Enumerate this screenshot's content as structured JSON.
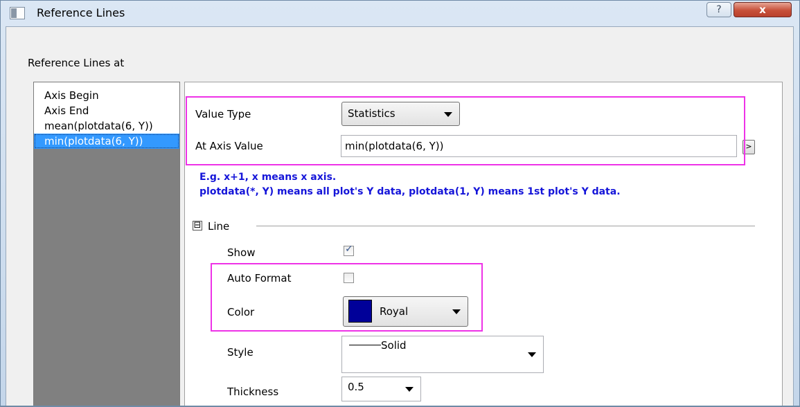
{
  "window": {
    "title": "Reference Lines",
    "help_glyph": "?",
    "close_glyph": "x"
  },
  "group_label": "Reference Lines at",
  "ref_list": {
    "items": [
      {
        "label": "Axis Begin",
        "selected": false
      },
      {
        "label": "Axis End",
        "selected": false
      },
      {
        "label": "mean(plotdata(6, Y))",
        "selected": false
      },
      {
        "label": "min(plotdata(6, Y))",
        "selected": true
      }
    ]
  },
  "value_type": {
    "label": "Value Type",
    "selected": "Statistics"
  },
  "axis_value": {
    "label": "At Axis Value",
    "value": "min(plotdata(6, Y))",
    "expand_glyph": ">"
  },
  "hint": {
    "line1": "E.g. x+1, x means x axis.",
    "line2": "plotdata(*, Y) means all plot's Y data, plotdata(1, Y) means 1st plot's Y data."
  },
  "line_section": {
    "toggle_glyph": "⊟",
    "title": "Line",
    "show": {
      "label": "Show",
      "checked": true
    },
    "auto_format": {
      "label": "Auto Format",
      "checked": false
    },
    "color": {
      "label": "Color",
      "value": "Royal",
      "swatch": "#000099"
    },
    "style": {
      "label": "Style",
      "value": "Solid"
    },
    "thickness": {
      "label": "Thickness",
      "value": "0.5"
    }
  },
  "colors": {
    "highlight": "#ee32e7",
    "hint_text": "#1515d9",
    "selection": "#3399ff"
  }
}
